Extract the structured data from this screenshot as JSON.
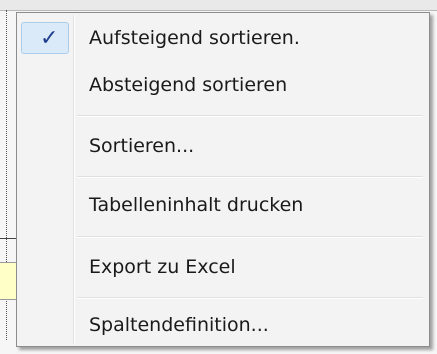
{
  "background": {
    "top_text": "",
    "bottom_text": ""
  },
  "menu": {
    "items": [
      {
        "label": "Aufsteigend sortieren.",
        "checked": true,
        "icon": "checkmark-icon"
      },
      {
        "label": "Absteigend sortieren",
        "checked": false
      },
      {
        "label": "Sortieren...",
        "checked": false
      },
      {
        "label": "Tabelleninhalt drucken",
        "checked": false
      },
      {
        "label": "Export zu Excel",
        "checked": false
      },
      {
        "label": "Spaltendefinition...",
        "checked": false
      }
    ],
    "check_symbol": "✓",
    "colors": {
      "menu_background": "#f3f3f3",
      "highlight_background": "#dbeaf8",
      "highlight_border": "#a9cdea",
      "check_color": "#1f3f8f"
    }
  }
}
